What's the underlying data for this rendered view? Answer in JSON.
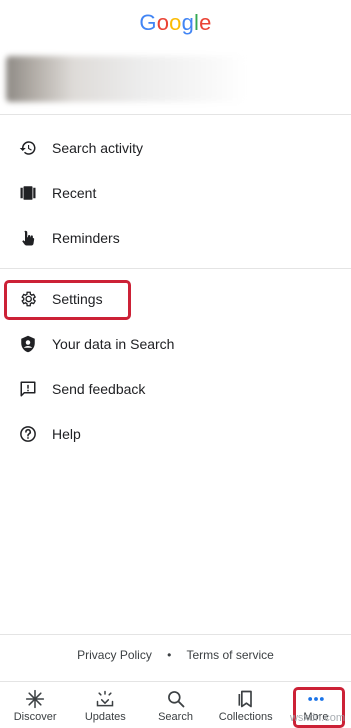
{
  "header": {
    "logo_letters": [
      {
        "ch": "G",
        "color": "#4285F4"
      },
      {
        "ch": "o",
        "color": "#EA4335"
      },
      {
        "ch": "o",
        "color": "#FBBC05"
      },
      {
        "ch": "g",
        "color": "#4285F4"
      },
      {
        "ch": "l",
        "color": "#34A853"
      },
      {
        "ch": "e",
        "color": "#EA4335"
      }
    ]
  },
  "menu": {
    "search_activity": {
      "label": "Search activity",
      "icon": "history-icon"
    },
    "recent": {
      "label": "Recent",
      "icon": "recent-cards-icon"
    },
    "reminders": {
      "label": "Reminders",
      "icon": "hand-pointer-icon"
    },
    "settings": {
      "label": "Settings",
      "icon": "gear-icon"
    },
    "your_data": {
      "label": "Your data in Search",
      "icon": "shield-person-icon"
    },
    "send_feedback": {
      "label": "Send feedback",
      "icon": "feedback-icon"
    },
    "help": {
      "label": "Help",
      "icon": "help-icon"
    }
  },
  "footer": {
    "privacy": "Privacy Policy",
    "separator": "•",
    "terms": "Terms of service"
  },
  "bottom_nav": {
    "discover": {
      "label": "Discover",
      "icon": "asterisk-icon"
    },
    "updates": {
      "label": "Updates",
      "icon": "updates-icon"
    },
    "search": {
      "label": "Search",
      "icon": "search-icon"
    },
    "collections": {
      "label": "Collections",
      "icon": "bookmark-icon"
    },
    "more": {
      "label": "More",
      "icon": "more-dots-icon"
    }
  },
  "accent_colors": {
    "highlight_border": "#cc2136",
    "more_icon": "#1a73e8"
  },
  "watermark": "wsxdn.com"
}
